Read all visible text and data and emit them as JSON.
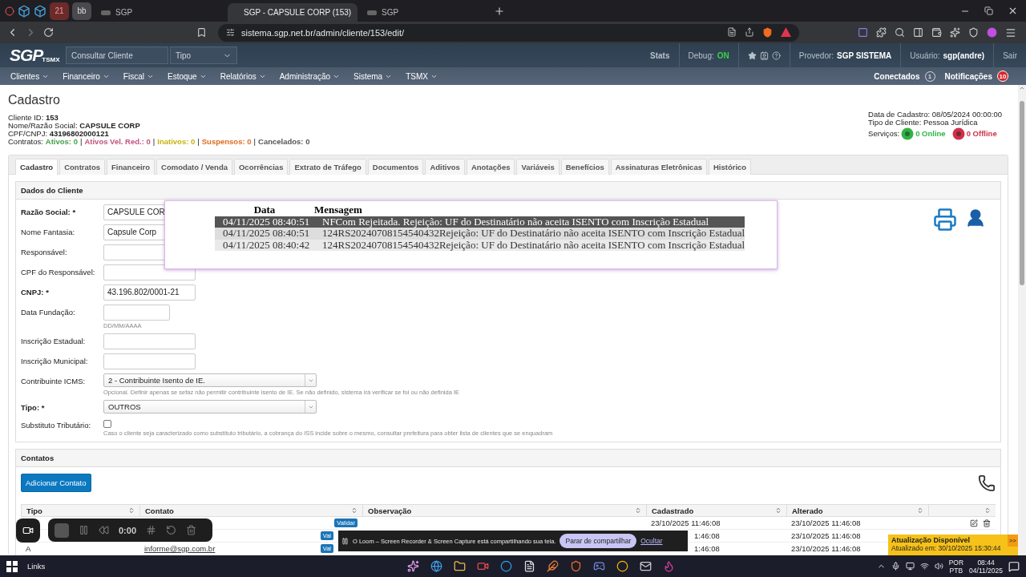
{
  "browser": {
    "tabs": [
      {
        "kind": "pinned",
        "label": "21",
        "selected": false
      },
      {
        "kind": "pinned",
        "label": "bb",
        "selected": false
      },
      {
        "kind": "page",
        "label": "SGP",
        "selected": false
      },
      {
        "kind": "page",
        "label": "SGP - CAPSULE CORP (153)",
        "selected": true
      },
      {
        "kind": "page",
        "label": "SGP",
        "selected": false
      }
    ],
    "address": "sistema.sgp.net.br/admin/cliente/153/edit/"
  },
  "header": {
    "logo": "SGP",
    "logo_sub": "TSMX",
    "search": {
      "placeholder": "Consultar Cliente"
    },
    "type_select": {
      "value": "Tipo"
    },
    "stats": "Stats",
    "debug": {
      "label": "Debug:",
      "value": "ON"
    },
    "provider": {
      "label": "Provedor:",
      "value": "SGP SISTEMA"
    },
    "user": {
      "label": "Usuário:",
      "value": "sgp(andre)"
    },
    "logout": "Sair"
  },
  "menu": {
    "items": [
      "Clientes",
      "Financeiro",
      "Fiscal",
      "Estoque",
      "Relatórios",
      "Administração",
      "Sistema",
      "TSMX"
    ],
    "connected": {
      "label": "Conectados",
      "count": "1"
    },
    "notifications": {
      "label": "Notificações",
      "count": "10"
    }
  },
  "client": {
    "title": "Cadastro",
    "info": [
      {
        "label": "Cliente ID:",
        "value": "153"
      },
      {
        "label": "Nome/Razão Social:",
        "value": "CAPSULE CORP"
      },
      {
        "label": "CPF/CNPJ:",
        "value": "43196802000121"
      }
    ],
    "contracts": {
      "label": "Contratos:",
      "separator": "|",
      "items": [
        {
          "label": "Ativos:",
          "value": "0",
          "color": "#43a047"
        },
        {
          "label": "Ativos Vel. Red.:",
          "value": "0",
          "color": "#c2527e"
        },
        {
          "label": "Inativos:",
          "value": "0",
          "color": "#c9b20a"
        },
        {
          "label": "Suspensos:",
          "value": "0",
          "color": "#dd6b20"
        },
        {
          "label": "Cancelados:",
          "value": "0",
          "color": "#555555"
        }
      ]
    },
    "meta": [
      "Data de Cadastro: 08/05/2024 00:00:00",
      "Tipo de Cliente: Pessoa Jurídica"
    ],
    "services": {
      "label": "Serviços:",
      "items": [
        {
          "label": "0 Online",
          "color": "#2fb344"
        },
        {
          "label": "0 Offline",
          "color": "#d0304a"
        }
      ]
    }
  },
  "tabs": [
    {
      "label": "Cadastro",
      "selected": true
    },
    {
      "label": "Contratos",
      "selected": false
    },
    {
      "label": "Financeiro",
      "selected": false
    },
    {
      "label": "Comodato / Venda",
      "selected": false
    },
    {
      "label": "Ocorrências",
      "selected": false
    },
    {
      "label": "Extrato de Tráfego",
      "selected": false
    },
    {
      "label": "Documentos",
      "selected": false
    },
    {
      "label": "Aditivos",
      "selected": false
    },
    {
      "label": "Anotações",
      "selected": false
    },
    {
      "label": "Variáveis",
      "selected": false
    },
    {
      "label": "Benefícios",
      "selected": false
    },
    {
      "label": "Assinaturas Eletrônicas",
      "selected": false
    },
    {
      "label": "Histórico",
      "selected": false
    }
  ],
  "form": {
    "title": "Dados do Cliente",
    "fields": [
      {
        "kind": "text",
        "label": "Razão Social: *",
        "required": true,
        "value": "CAPSULE COR"
      },
      {
        "kind": "text",
        "label": "Nome Fantasia:",
        "required": false,
        "value": "Capsule Corp"
      },
      {
        "kind": "text",
        "label": "Responsável:",
        "required": false
      },
      {
        "kind": "text",
        "label": "CPF do Responsável:",
        "required": false
      },
      {
        "kind": "text",
        "label": "CNPJ: *",
        "required": true,
        "value": "43.196.802/0001-21"
      },
      {
        "kind": "date",
        "label": "Data Fundação:",
        "required": false,
        "hint": "DD/MM/AAAA"
      },
      {
        "kind": "text",
        "label": "Inscrição Estadual:",
        "required": false
      },
      {
        "kind": "text",
        "label": "Inscrição Municipal:",
        "required": false
      },
      {
        "kind": "select",
        "label": "Contribuinte ICMS:",
        "required": false,
        "value": "2 - Contribuinte Isento de IE.",
        "hint": "Opcional. Definir apenas se sefaz não permitir contribuinte isento de IE. Se não definido, sistema irá verificar se foi ou não definida IE"
      },
      {
        "kind": "select",
        "label": "Tipo: *",
        "required": true,
        "value": "OUTROS"
      },
      {
        "kind": "checkbox",
        "label": "Substituto Tributário:",
        "required": false,
        "checked": false,
        "hint": "Caso o cliente seja caracterizado como substituto tributário, a cobrança do ISS incide sobre o mesmo, consultar prefeitura para obter lista de clientes que se enquadram"
      }
    ]
  },
  "popup": {
    "columns": [
      "Data",
      "Mensagem"
    ],
    "rows": [
      {
        "date": "04/11/2025 08:40:51",
        "message": "NFCom Rejeitada. Rejeição: UF do Destinatário não aceita ISENTO com Inscrição Estadual",
        "selected": true
      },
      {
        "date": "04/11/2025 08:40:51",
        "message": "124RS20240708154540432Rejeição: UF do Destinatário não aceita ISENTO com Inscrição Estadual",
        "selected": false
      },
      {
        "date": "04/11/2025 08:40:42",
        "message": "124RS20240708154540432Rejeição: UF do Destinatário não aceita ISENTO com Inscrição Estadual",
        "selected": false
      }
    ]
  },
  "contacts": {
    "title": "Contatos",
    "add_button": "Adicionar Contato",
    "columns": [
      "Tipo",
      "Contato",
      "Observação",
      "Cadastrado",
      "Alterado"
    ],
    "rows": [
      {
        "badge": "Validar",
        "cadastrado": "23/10/2025 11:46:08",
        "alterado": "23/10/2025 11:46:08",
        "actions": true,
        "under_notice": false
      },
      {
        "badge": "Val",
        "cadastrado": "1:46:08",
        "alterado": "23/10/2025 11:46:08",
        "under_notice": true
      },
      {
        "tipo": "A",
        "contato": "informe@sgp.com.br",
        "badge": "Val",
        "cadastrado": "1:46:08",
        "alterado": "23/10/2025 11:46:08",
        "under_notice": true
      }
    ]
  },
  "recorder": {
    "time": "0:00"
  },
  "share_notice": {
    "text": "O Loom – Screen Recorder & Screen Capture está compartilhando sua tela.",
    "stop_button": "Parar de compartilhar",
    "hide_link": "Ocultar"
  },
  "update_toast": {
    "title": "Atualização Disponível",
    "subtitle": "Atualizado em: 30/10/2025 15:30:44",
    "expand": ">>"
  },
  "taskbar": {
    "links": "Links",
    "lang": "POR",
    "layout": "PTB",
    "time": "08:44",
    "date": "04/11/2025"
  }
}
